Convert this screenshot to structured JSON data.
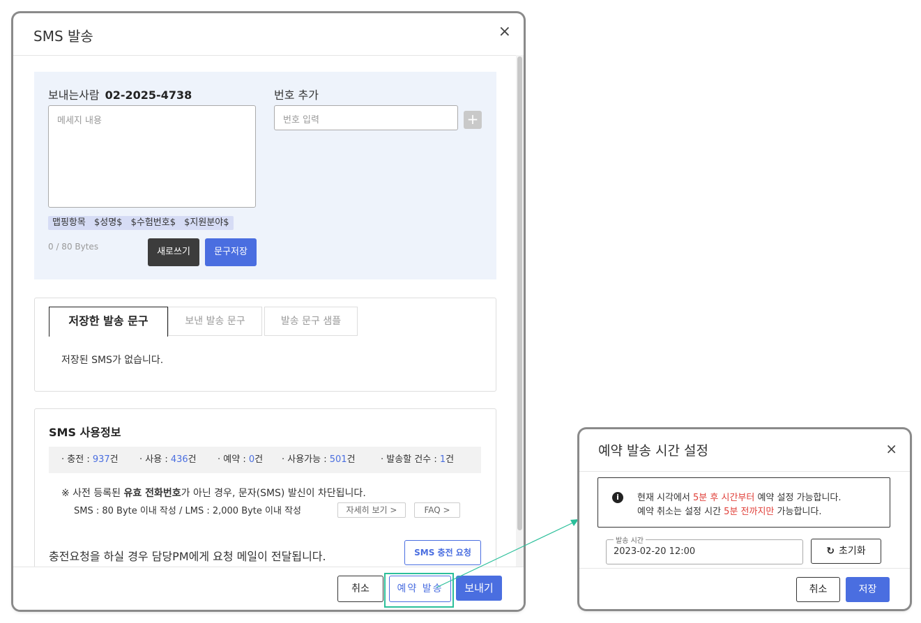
{
  "sms_dialog": {
    "title": "SMS 발송",
    "close_icon": "×",
    "sender_label": "보내는사람",
    "sender_number": "02-2025-4738",
    "message_placeholder": "메세지 내용",
    "mapping": [
      "맵핑항목",
      "$성명$",
      "$수험번호$",
      "$지원분야$"
    ],
    "bytes": "0 / 80 Bytes",
    "new_button": "새로쓰기",
    "save_text_button": "문구저장",
    "add_number_label": "번호 추가",
    "number_placeholder": "번호 입력",
    "add_icon": "+",
    "tabs": [
      "저장한 발송 문구",
      "보낸 발송 문구",
      "발송 문구 샘플"
    ],
    "no_saved": "저장된 SMS가 없습니다.",
    "usage": {
      "title": "SMS 사용정보",
      "stats": [
        {
          "label": "· 충전 : ",
          "num": "937",
          "unit": "건"
        },
        {
          "label": "· 사용 : ",
          "num": "436",
          "unit": "건"
        },
        {
          "label": "· 예약 : ",
          "num": "0",
          "unit": "건"
        },
        {
          "label": "· 사용가능 : ",
          "num": "501",
          "unit": "건"
        },
        {
          "label": "· 발송할 건수 : ",
          "num": "1",
          "unit": "건"
        }
      ],
      "notice_prefix": "※ 사전 등록된 ",
      "notice_bold": "유효 전화번호",
      "notice_suffix": "가 아닌 경우, 문자(SMS) 발신이 차단됩니다.",
      "notice2": "SMS : 80 Byte 이내 작성 / LMS : 2,000 Byte 이내 작성",
      "detail_button": "자세히 보기 >",
      "faq_button": "FAQ >",
      "charge_text": "충전요청을 하실 경우 담당PM에게 요청 메일이 전달됩니다.",
      "charge_button": "SMS 충전 요청"
    },
    "footer": {
      "cancel": "취소",
      "reserve": "예약 발송",
      "send": "보내기"
    }
  },
  "schedule_dialog": {
    "title": "예약 발송 시간 설정",
    "close_icon": "×",
    "info_icon": "i",
    "line1_a": "현재 시각에서 ",
    "line1_red": "5분 후 시간부터",
    "line1_b": " 예약 설정 가능합니다.",
    "line2_a": "예약 취소는 설정 시간 ",
    "line2_red": "5분 전까지만",
    "line2_b": " 가능합니다.",
    "time_label": "발송 시간",
    "time_value": "2023-02-20 12:00",
    "reset_icon": "↻",
    "reset_label": "초기화",
    "cancel": "취소",
    "save": "저장"
  },
  "colors": {
    "accent": "#4a6ee0",
    "highlight": "#2bbf9a",
    "warning_red": "#e0403a"
  }
}
